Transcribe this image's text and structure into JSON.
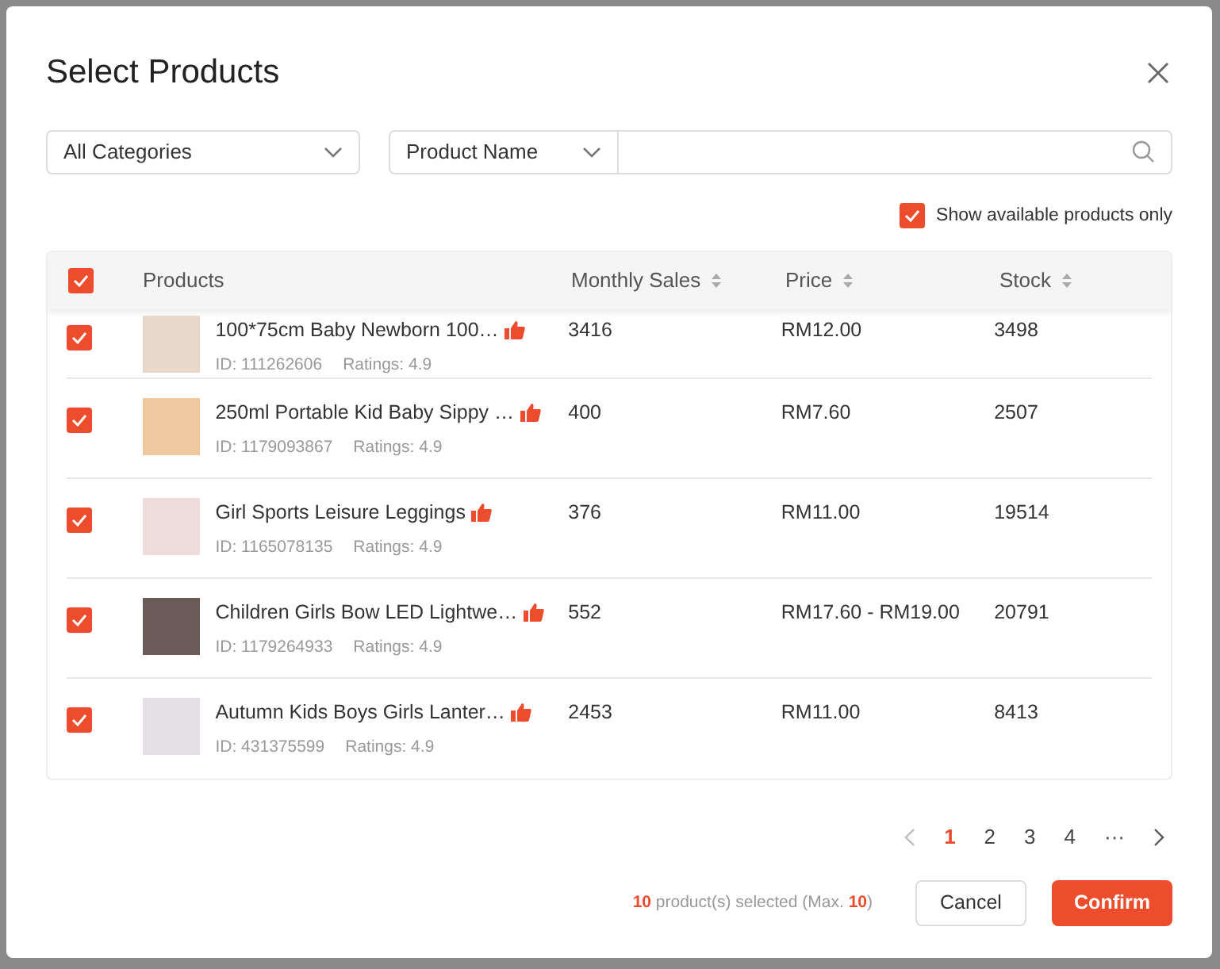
{
  "dialog": {
    "title": "Select Products"
  },
  "filters": {
    "category": "All Categories",
    "search_by": "Product Name"
  },
  "available_only": {
    "label": "Show available products only",
    "checked": true
  },
  "table": {
    "all_checked": true,
    "columns": [
      {
        "label": "Products",
        "sortable": false
      },
      {
        "label": "Monthly Sales",
        "sortable": true
      },
      {
        "label": "Price",
        "sortable": true
      },
      {
        "label": "Stock",
        "sortable": true
      }
    ],
    "rows": [
      {
        "checked": true,
        "name": "100*75cm Baby Newborn 100…",
        "id": "ID: 111262606",
        "ratings": "Ratings: 4.9",
        "monthly_sales": "3416",
        "price": "RM12.00",
        "stock": "3498",
        "color": "#e8d8cc"
      },
      {
        "checked": true,
        "name": "250ml Portable Kid Baby Sippy …",
        "id": "ID: 1179093867",
        "ratings": "Ratings: 4.9",
        "monthly_sales": "400",
        "price": "RM7.60",
        "stock": "2507",
        "color": "#f0c8a0"
      },
      {
        "checked": true,
        "name": "Girl Sports Leisure Leggings",
        "id": "ID: 1165078135",
        "ratings": "Ratings: 4.9",
        "monthly_sales": "376",
        "price": "RM11.00",
        "stock": "19514",
        "color": "#eedcdc"
      },
      {
        "checked": true,
        "name": "Children Girls Bow LED Lightwe…",
        "id": "ID: 1179264933",
        "ratings": "Ratings: 4.9",
        "monthly_sales": "552",
        "price": "RM17.60 - RM19.00",
        "stock": "20791",
        "color": "#6a5a58"
      },
      {
        "checked": true,
        "name": "Autumn Kids Boys Girls Lanter…",
        "id": "ID: 431375599",
        "ratings": "Ratings: 4.9",
        "monthly_sales": "2453",
        "price": "RM11.00",
        "stock": "8413",
        "color": "#e4e0e6"
      }
    ]
  },
  "pagination": {
    "pages": [
      {
        "label": "1",
        "selected": true
      },
      {
        "label": "2",
        "selected": false
      },
      {
        "label": "3",
        "selected": false
      },
      {
        "label": "4",
        "selected": false
      },
      {
        "label": "···",
        "selected": false
      }
    ]
  },
  "footer": {
    "count": "10",
    "text": "product(s) selected (Max.",
    "max": "10",
    "end": ")",
    "buttons": [
      {
        "label": "Cancel",
        "kind": "secondary"
      },
      {
        "label": "Confirm",
        "kind": "primary"
      }
    ]
  }
}
